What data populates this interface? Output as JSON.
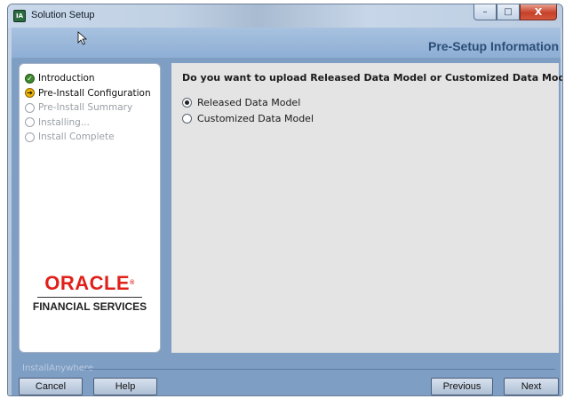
{
  "window": {
    "title": "Solution Setup",
    "app_icon_text": "IA",
    "minimize_glyph": "–",
    "maximize_glyph": "□",
    "close_glyph": "X"
  },
  "header": {
    "page_title": "Pre-Setup Information"
  },
  "steps": [
    {
      "label": "Introduction",
      "state": "done"
    },
    {
      "label": "Pre-Install Configuration",
      "state": "current"
    },
    {
      "label": "Pre-Install Summary",
      "state": "pending"
    },
    {
      "label": "Installing...",
      "state": "pending"
    },
    {
      "label": "Install Complete",
      "state": "pending"
    }
  ],
  "logo": {
    "oracle": "ORACLE",
    "tm": "®",
    "subtitle": "FINANCIAL SERVICES"
  },
  "content": {
    "question": "Do you want to upload Released Data Model or Customized Data Model ?",
    "options": [
      {
        "label": "Released Data Model",
        "selected": true
      },
      {
        "label": "Customized Data Model",
        "selected": false
      }
    ]
  },
  "footer": {
    "brand": "InstallAnywhere",
    "cancel_label": "Cancel",
    "help_label": "Help",
    "previous_label": "Previous",
    "next_label": "Next"
  },
  "colors": {
    "header_band": "#a8c2e0",
    "body_blue": "#7f9ec3",
    "oracle_red": "#e0211b",
    "title_blue": "#2b4e78"
  }
}
